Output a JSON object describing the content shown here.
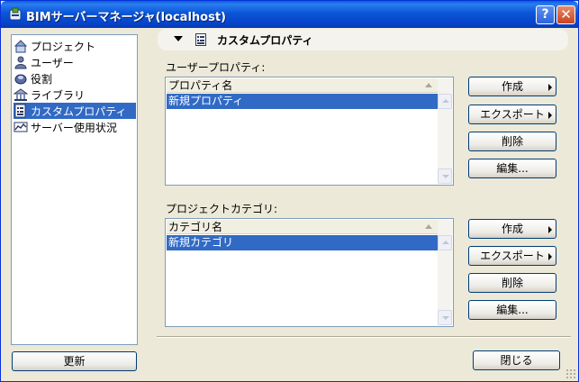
{
  "window": {
    "title": "BIMサーバーマネージャ(localhost)",
    "help_label": "?",
    "close_label": "✕"
  },
  "nav": {
    "items": [
      {
        "label": "プロジェクト",
        "icon": "project-icon"
      },
      {
        "label": "ユーザー",
        "icon": "user-icon"
      },
      {
        "label": "役割",
        "icon": "role-icon"
      },
      {
        "label": "ライブラリ",
        "icon": "library-icon"
      },
      {
        "label": "カスタムプロパティ",
        "icon": "custom-property-icon",
        "selected": true
      },
      {
        "label": "サーバー使用状況",
        "icon": "server-usage-icon"
      }
    ],
    "refresh_label": "更新"
  },
  "section": {
    "title": "カスタムプロパティ"
  },
  "user_properties": {
    "label": "ユーザープロパティ:",
    "column_header": "プロパティ名",
    "rows": [
      "新規プロパティ"
    ],
    "buttons": {
      "create": "作成",
      "export": "エクスポート",
      "delete": "削除",
      "edit": "編集..."
    }
  },
  "project_categories": {
    "label": "プロジェクトカテゴリ:",
    "column_header": "カテゴリ名",
    "rows": [
      "新規カテゴリ"
    ],
    "buttons": {
      "create": "作成",
      "export": "エクスポート",
      "delete": "削除",
      "edit": "編集..."
    }
  },
  "footer": {
    "close_label": "閉じる"
  },
  "colors": {
    "selection": "#316AC5",
    "titlebar": "#0B56D8",
    "dialog_bg": "#ECE9D8"
  }
}
